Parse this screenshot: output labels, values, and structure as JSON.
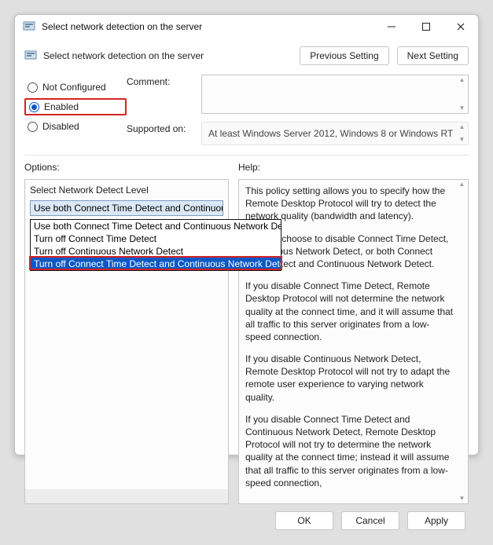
{
  "window": {
    "title": "Select network detection on the server"
  },
  "header": {
    "title": "Select network detection on the server",
    "prev": "Previous Setting",
    "next": "Next Setting"
  },
  "state": {
    "not_configured": "Not Configured",
    "enabled": "Enabled",
    "disabled": "Disabled"
  },
  "comment": {
    "label": "Comment:"
  },
  "supported": {
    "label": "Supported on:",
    "value": "At least Windows Server 2012, Windows 8 or Windows RT"
  },
  "options": {
    "label": "Options:",
    "field_label": "Select Network Detect Level",
    "selected": "Use both Connect Time Detect and Continuous Network Detect",
    "items": [
      "Use both Connect Time Detect and Continuous Network Detect",
      "Turn off Connect Time Detect",
      "Turn off Continuous Network Detect",
      "Turn off Connect Time Detect and Continuous Network Detect"
    ]
  },
  "help": {
    "label": "Help:",
    "p1": "This policy setting allows you to specify how the Remote Desktop Protocol will try to detect the network quality (bandwidth and latency).",
    "p2": "You can choose to disable Connect Time Detect, Continuous Network Detect, or both Connect Time Detect and Continuous Network Detect.",
    "p3": "If you disable Connect Time Detect, Remote Desktop Protocol will not determine the network quality at the connect time, and it will assume that all traffic to this server originates from a low-speed connection.",
    "p4": "If you disable Continuous Network Detect, Remote Desktop Protocol will not try to adapt the remote user experience to varying network quality.",
    "p5": "If you disable Connect Time Detect and Continuous Network Detect, Remote Desktop Protocol will not try to determine the network quality at the connect time; instead it will assume that all traffic to this server originates from a low-speed connection,"
  },
  "footer": {
    "ok": "OK",
    "cancel": "Cancel",
    "apply": "Apply"
  }
}
